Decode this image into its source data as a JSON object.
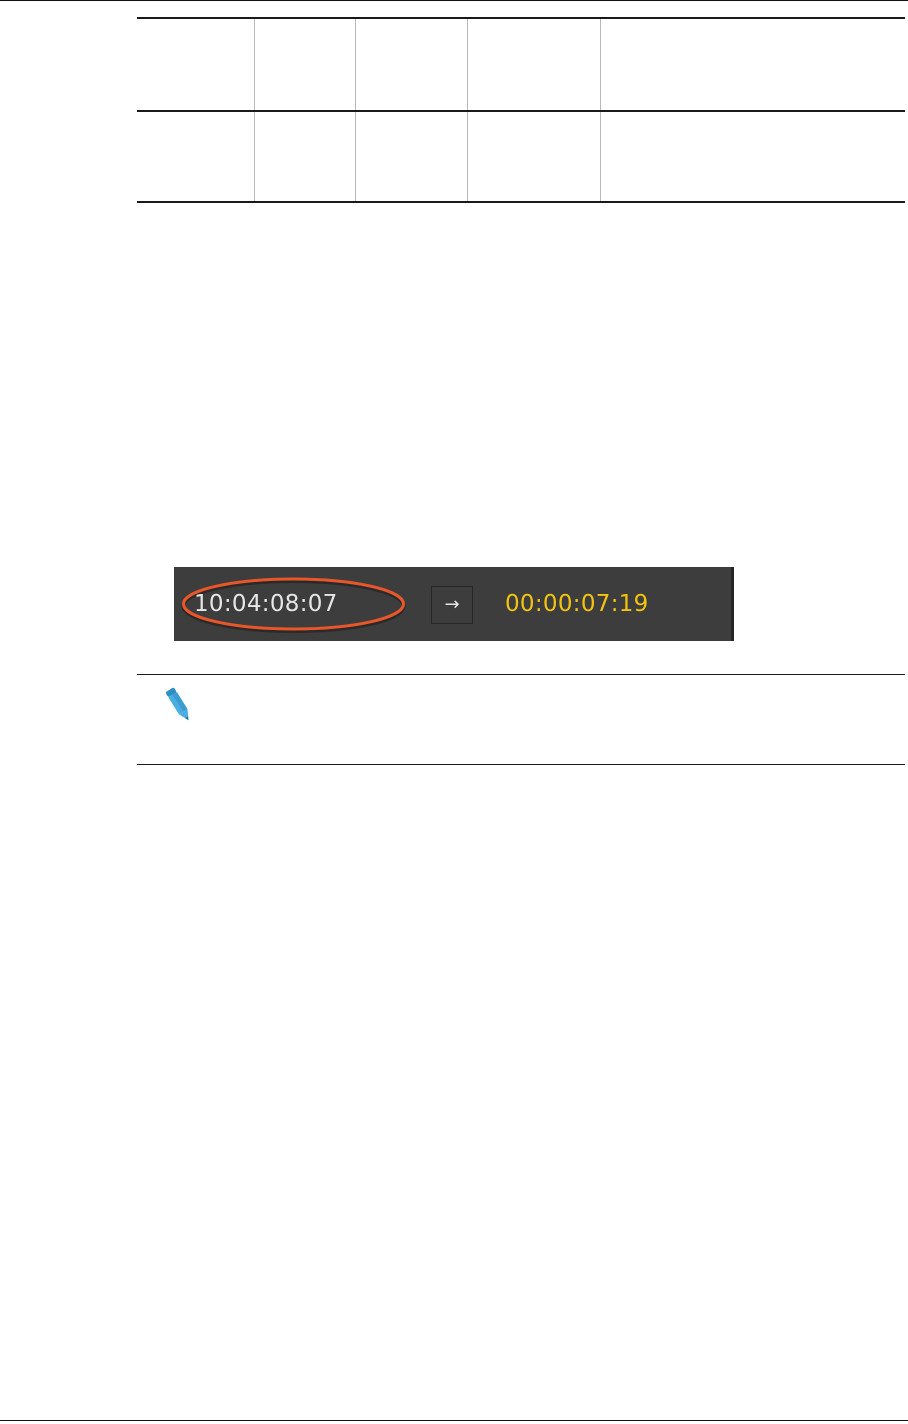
{
  "table": {
    "header": [
      "",
      "",
      "",
      "",
      ""
    ],
    "rows": [
      [
        "",
        "",
        "",
        "",
        ""
      ]
    ]
  },
  "timecode_bar": {
    "current_timecode": "10:04:08:07",
    "duration_timecode": "00:00:07:19",
    "arrow_glyph": "→",
    "highlight_color": "#e8562a",
    "duration_color": "#f2c40f",
    "bar_color": "#3d3d3d"
  },
  "note": {
    "icon": "pencil-icon",
    "icon_color": "#4aaee0",
    "text": ""
  }
}
